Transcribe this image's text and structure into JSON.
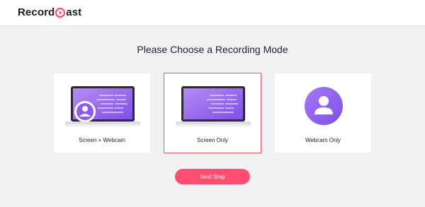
{
  "header": {
    "logo_left": "Record",
    "logo_right": "ast"
  },
  "main": {
    "title": "Please Choose a Recording Mode",
    "modes": [
      {
        "label": "Screen + Webcam",
        "selected": false
      },
      {
        "label": "Screen Only",
        "selected": true
      },
      {
        "label": "Webcam Only",
        "selected": false
      }
    ],
    "next_label": "Next Step"
  },
  "colors": {
    "accent": "#ff4d72",
    "purple": "#8a5cf0"
  }
}
